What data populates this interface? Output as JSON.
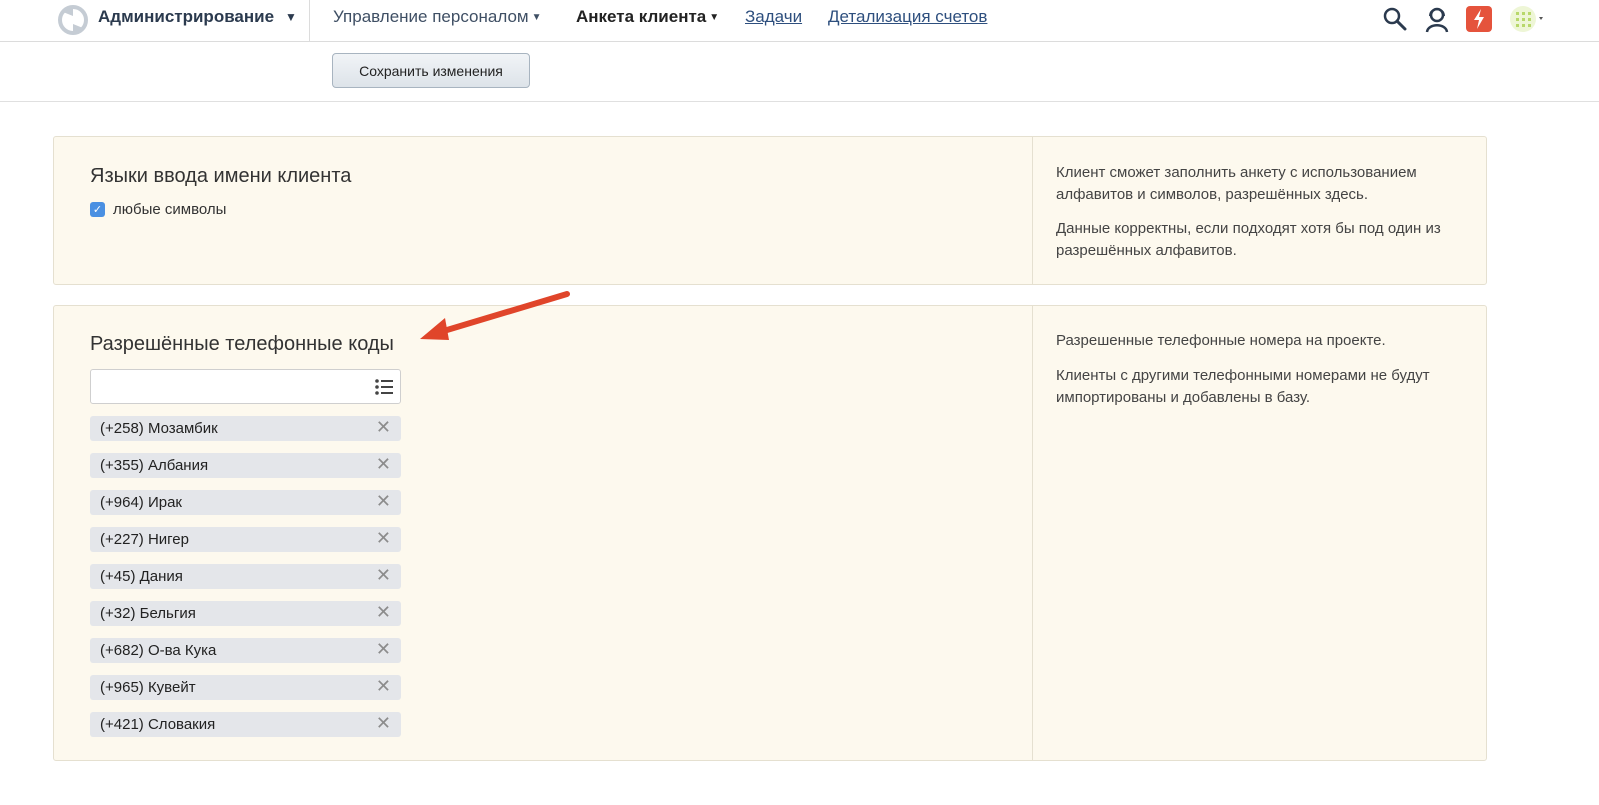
{
  "header": {
    "app_menu_label": "Администрирование",
    "nav": [
      {
        "label": "Управление персоналом",
        "has_caret": true
      },
      {
        "label": "Анкета клиента",
        "has_caret": true,
        "active": true
      },
      {
        "label": "Задачи"
      },
      {
        "label": "Детализация счетов"
      }
    ],
    "icons": [
      "logo-icon",
      "search-icon",
      "support-agent-icon",
      "lightning-icon",
      "grid-apps-icon"
    ]
  },
  "toolbar": {
    "save_label": "Сохранить изменения"
  },
  "name_languages": {
    "title": "Языки ввода имени клиента",
    "checkbox_label": "любые символы",
    "checked": true,
    "hint_1": "Клиент сможет заполнить анкету с использованием алфавитов и символов, разрешённых здесь.",
    "hint_2": "Данные корректны, если подходят хотя бы под один из разрешённых алфавитов."
  },
  "phone_codes": {
    "title": "Разрешённые телефонные коды",
    "search_value": "",
    "items": [
      "(+258) Мозамбик",
      "(+355) Албания",
      "(+964) Ирак",
      "(+227) Нигер",
      "(+45) Дания",
      "(+32) Бельгия",
      "(+682) О-ва Кука",
      "(+965) Кувейт",
      "(+421) Словакия"
    ],
    "hint_1": "Разрешенные телефонные номера на проекте.",
    "hint_2": "Клиенты с другими телефонными номерами не будут импортированы и добавлены в базу."
  },
  "colors": {
    "panel_bg": "#fdf9ee",
    "accent": "#4a90e2",
    "arrow": "#e0452a",
    "link": "#2e4f7e"
  }
}
